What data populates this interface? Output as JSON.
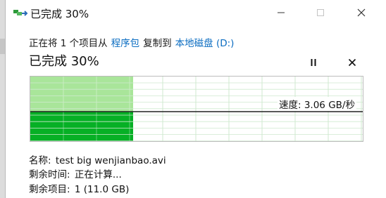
{
  "window": {
    "title": "已完成 30%",
    "controls": {
      "minimize": "minimize-icon",
      "maximize": "maximize-icon",
      "close": "close-icon"
    }
  },
  "copy_line": {
    "prefix": "正在将 1 个项目从",
    "source": "程序包",
    "middle": "复制到",
    "destination": "本地磁盘 (D:)"
  },
  "progress": {
    "title": "已完成 30%",
    "fraction": 0.3,
    "speed_label": "速度: 3.06 GB/秒"
  },
  "details": {
    "name_label": "名称:",
    "name_value": "test big wenjianbao.avi",
    "time_label": "剩余时间:",
    "time_value": "正在计算...",
    "items_label": "剩余项目:",
    "items_value": "1 (11.0 GB)"
  },
  "colors": {
    "graph_fill": "#06b025",
    "graph_upper_fill": "#a9e59a",
    "grid": "#cfe9cf",
    "link": "#0a6cc1"
  }
}
